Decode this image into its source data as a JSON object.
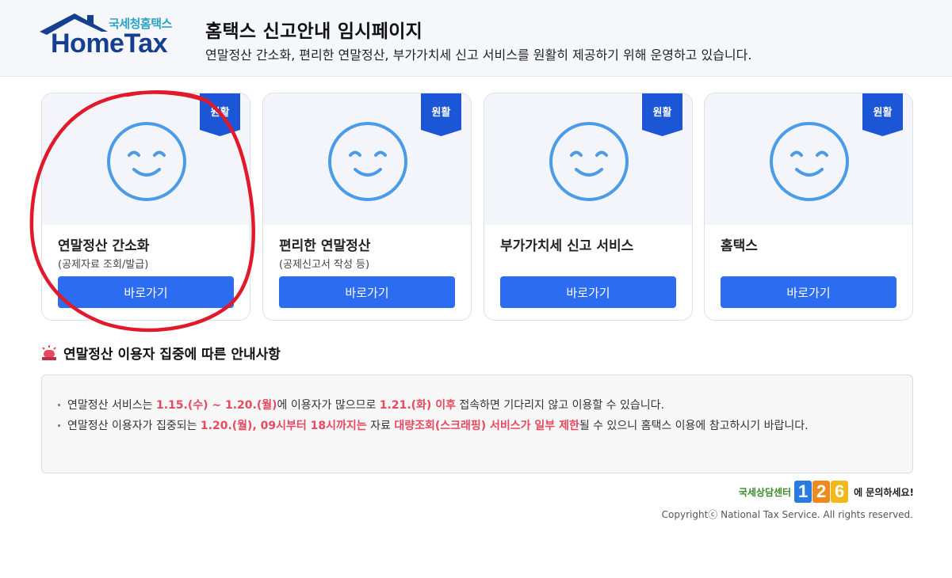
{
  "header": {
    "logo_sub": "국세청홈택스",
    "logo_main": "HomeTax",
    "title": "홈택스 신고안내 임시페이지",
    "description": "연말정산 간소화, 편리한 연말정산, 부가가치세 신고 서비스를 원활히 제공하기 위해 운영하고 있습니다."
  },
  "cards": [
    {
      "badge": "원활",
      "title": "연말정산 간소화",
      "subtitle": "(공제자료 조회/발급)",
      "button": "바로가기"
    },
    {
      "badge": "원활",
      "title": "편리한 연말정산",
      "subtitle": "(공제신고서 작성 등)",
      "button": "바로가기"
    },
    {
      "badge": "원활",
      "title": "부가가치세 신고 서비스",
      "subtitle": "",
      "button": "바로가기"
    },
    {
      "badge": "원활",
      "title": "홈택스",
      "subtitle": "",
      "button": "바로가기"
    }
  ],
  "notice": {
    "heading": "연말정산 이용자 집중에 따른 안내사항",
    "line1": {
      "t1": "연말정산 서비스는 ",
      "h1": "1.15.(수) ~ 1.20.(월)",
      "t2": "에 이용자가 많으므로 ",
      "h2": "1.21.(화) 이후",
      "t3": " 접속하면 기다리지 않고 이용할 수 있습니다."
    },
    "line2": {
      "t1": "연말정산 이용자가 집중되는 ",
      "h1": "1.20.(월), 09시부터 18시까지는",
      "t2": " 자료 ",
      "h2": "대량조회(스크래핑) 서비스가 일부 제한",
      "t3": "될 수 있으니 홈택스 이용에 참고하시기 바랍니다."
    }
  },
  "footer": {
    "contact_label": "국세상담센터",
    "contact_digits": [
      "1",
      "2",
      "6"
    ],
    "contact_text": "에 문의하세요!",
    "copyright": "Copyrightⓒ National Tax Service. All rights reserved."
  },
  "colors": {
    "primary_button": "#2b6cf0",
    "badge": "#1a56d6",
    "highlight": "#e8495f",
    "smiley": "#4a9be8",
    "annotation": "#e0192b"
  },
  "icons": {
    "card_face": "smiley-face-icon",
    "notice": "siren-icon"
  }
}
